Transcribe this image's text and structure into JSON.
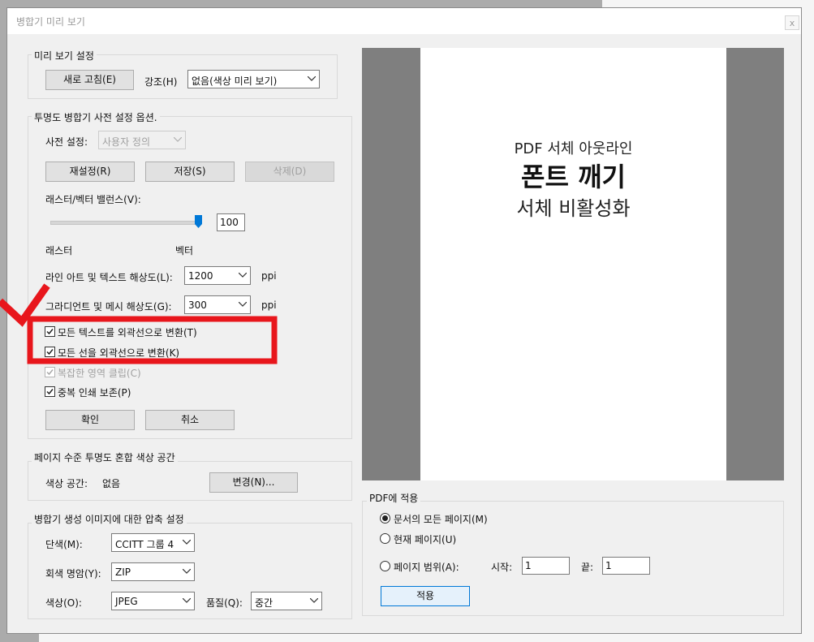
{
  "dialog": {
    "title": "병합기 미리 보기",
    "close_label": "x"
  },
  "preview_settings": {
    "legend": "미리 보기 설정",
    "refresh_button": "새로 고침(E)",
    "highlight_label": "강조(H)",
    "highlight_value": "없음(색상 미리 보기)"
  },
  "preset_options": {
    "legend": "투명도 병합기 사전 설정 옵션.",
    "preset_label": "사전 설정:",
    "preset_value": "사용자 정의",
    "reset_button": "재설정(R)",
    "save_button": "저장(S)",
    "delete_button": "삭제(D)",
    "balance_label": "래스터/벡터 밸런스(V):",
    "balance_value": "100",
    "balance_level": 1.0,
    "raster_label": "래스터",
    "vector_label": "벡터",
    "lineart_label": "라인 아트 및 텍스트 해상도(L):",
    "lineart_value": "1200",
    "gradient_label": "그라디언트 및 메시 해상도(G):",
    "gradient_value": "300",
    "ppi_unit": "ppi",
    "checkboxes": [
      {
        "label": "모든 텍스트를 외곽선으로 변환(T)",
        "checked": true,
        "disabled": false
      },
      {
        "label": "모든 선을 외곽선으로 변환(K)",
        "checked": true,
        "disabled": false
      },
      {
        "label": "복잡한 영역 클립(C)",
        "checked": true,
        "disabled": true
      },
      {
        "label": "중복 인쇄 보존(P)",
        "checked": true,
        "disabled": false
      }
    ],
    "ok_button": "확인",
    "cancel_button": "취소"
  },
  "blend_space": {
    "legend": "페이지 수준 투명도 혼합 색상 공간",
    "color_space_label": "색상 공간:",
    "color_space_value": "없음",
    "change_button": "변경(N)..."
  },
  "compression": {
    "legend": "병합기 생성 이미지에 대한 압축 설정",
    "mono_label": "단색(M):",
    "mono_value": "CCITT 그룹 4",
    "gray_label": "회색 명암(Y):",
    "gray_value": "ZIP",
    "color_label": "색상(O):",
    "color_value": "JPEG",
    "quality_label": "품질(Q):",
    "quality_value": "중간"
  },
  "preview_page": {
    "line1": "PDF 서체 아웃라인",
    "line2": "폰트 깨기",
    "line3": "서체 비활성화"
  },
  "apply_to_pdf": {
    "legend": "PDF에 적용",
    "all_pages": "문서의 모든 페이지(M)",
    "current_page": "현재 페이지(U)",
    "page_range": "페이지 범위(A):",
    "start_label": "시작:",
    "start_value": "1",
    "end_label": "끝:",
    "end_value": "1",
    "selected": "all_pages",
    "apply_button": "적용"
  },
  "annotation_color": "#e8161c"
}
